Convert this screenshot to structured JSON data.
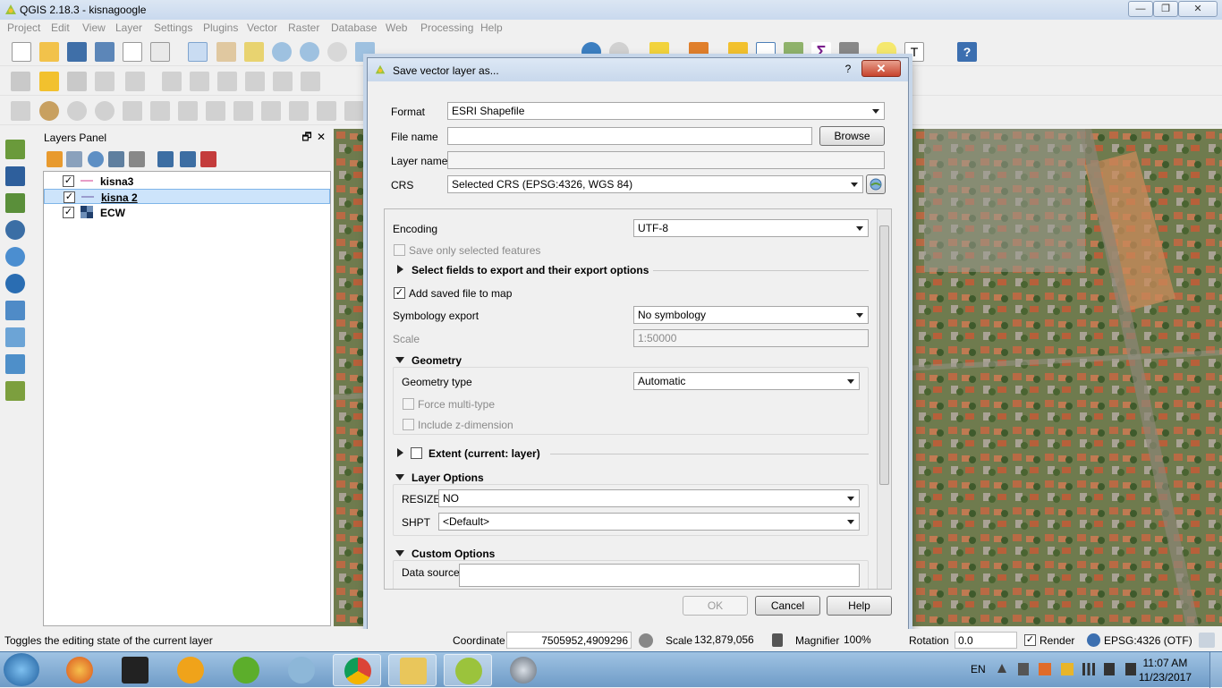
{
  "window": {
    "title": "QGIS 2.18.3 - kisnagoogle",
    "minimize": "—",
    "maximize": "❐",
    "close": "✕"
  },
  "menu": [
    "Project",
    "Edit",
    "View",
    "Layer",
    "Settings",
    "Plugins",
    "Vector",
    "Raster",
    "Database",
    "Web",
    "Processing",
    "Help"
  ],
  "layers_panel": {
    "title": "Layers Panel",
    "float_btn": "🗗",
    "close_btn": "✕",
    "layers": [
      {
        "name": "kisna3",
        "checked": "✓",
        "icon": "line-layer-icon"
      },
      {
        "name": "kisna 2",
        "checked": "✓",
        "icon": "line-layer-icon"
      },
      {
        "name": "ECW",
        "checked": "✓",
        "icon": "raster-layer-icon"
      }
    ]
  },
  "dialog": {
    "title": "Save vector layer as...",
    "help_btn": "?",
    "close_btn": "✕",
    "format_label": "Format",
    "format_value": "ESRI Shapefile",
    "filename_label": "File name",
    "filename_value": "",
    "browse": "Browse",
    "layername_label": "Layer name",
    "crs_label": "CRS",
    "crs_value": "Selected CRS (EPSG:4326, WGS 84)",
    "encoding_label": "Encoding",
    "encoding_value": "UTF-8",
    "save_selected": "Save only selected features",
    "select_fields": "Select fields to export and their export options",
    "add_saved": "Add saved file to map",
    "add_saved_check": "✓",
    "symbology_label": "Symbology export",
    "symbology_value": "No symbology",
    "scale_label": "Scale",
    "scale_value": "1:50000",
    "geometry_header": "Geometry",
    "geometry_type_label": "Geometry type",
    "geometry_type_value": "Automatic",
    "force_multi": "Force multi-type",
    "include_z": "Include z-dimension",
    "extent_header": "Extent (current: layer)",
    "layer_options_header": "Layer Options",
    "resize_label": "RESIZE",
    "resize_value": "NO",
    "shpt_label": "SHPT",
    "shpt_value": "<Default>",
    "custom_options_header": "Custom Options",
    "data_source_label": "Data source",
    "ok": "OK",
    "cancel": "Cancel",
    "help": "Help"
  },
  "status": {
    "message": "Toggles the editing state of the current layer",
    "coordinate_label": "Coordinate",
    "coordinate_value": "7505952,4909296",
    "scale_label": "Scale",
    "scale_value": "132,879,056",
    "magnifier_label": "Magnifier",
    "magnifier_value": "100%",
    "rotation_label": "Rotation",
    "rotation_value": "0.0",
    "render_label": "Render",
    "render_check": "✓",
    "crs": "EPSG:4326 (OTF)"
  },
  "taskbar": {
    "lang": "EN",
    "time": "11:07 AM",
    "date": "11/23/2017"
  },
  "colors": {
    "accent": "#3c7fc1",
    "close_red": "#c7442d",
    "selection": "#cde4fb"
  }
}
